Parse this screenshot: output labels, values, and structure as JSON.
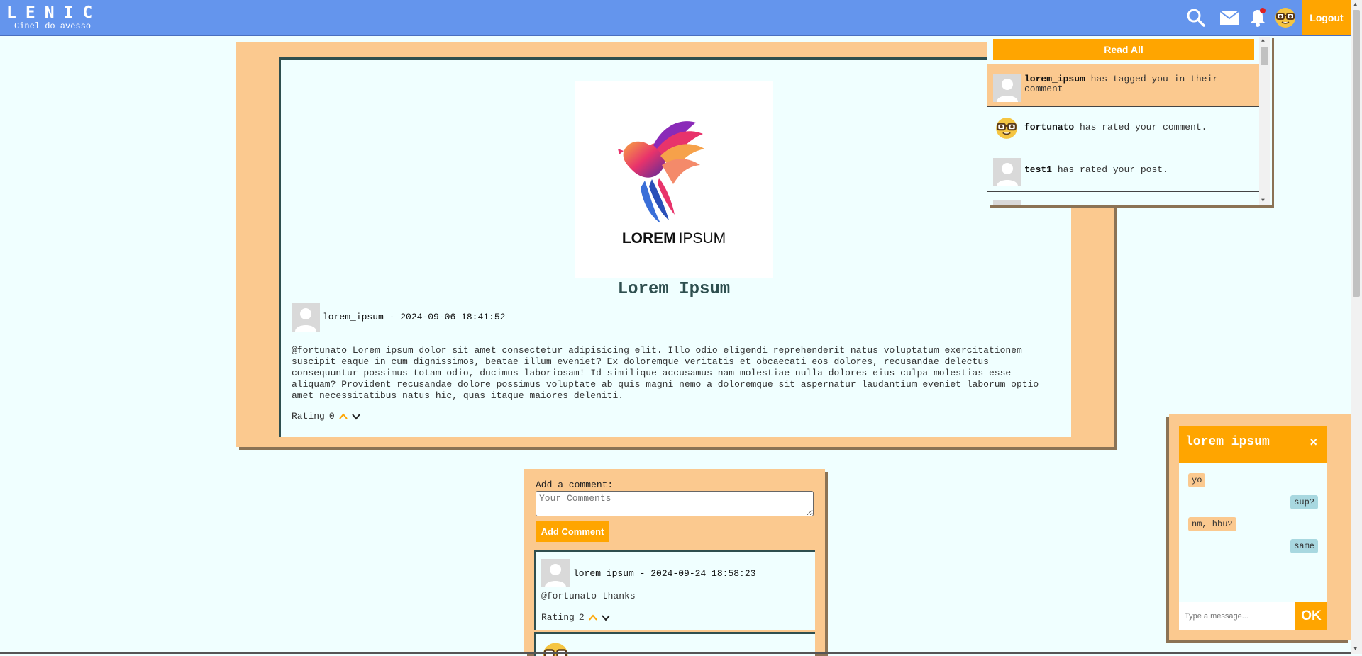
{
  "header": {
    "logo_title": "LENIC",
    "logo_subtitle": "Cinel do avesso",
    "logout_label": "Logout",
    "icons": [
      "search-icon",
      "mail-icon",
      "bell-icon",
      "profile-avatar"
    ]
  },
  "notifications": {
    "read_all_label": "Read All",
    "items": [
      {
        "user": "lorem_ipsum",
        "text": "has tagged you in their comment",
        "unread": true,
        "avatar": "default"
      },
      {
        "user": "fortunato",
        "text": "has rated your comment.",
        "unread": false,
        "avatar": "nerd-emoji"
      },
      {
        "user": "test1",
        "text": "has rated your post.",
        "unread": false,
        "avatar": "default"
      }
    ]
  },
  "post": {
    "image_text_1": "LOREM",
    "image_text_2": "IPSUM",
    "title": "Lorem Ipsum",
    "author": "lorem_ipsum",
    "date": "2024-09-06 18:41:52",
    "meta_separator": " - ",
    "body": "@fortunato Lorem ipsum dolor sit amet consectetur adipisicing elit. Illo odio eligendi reprehenderit natus voluptatum exercitationem suscipit eaque in cum dignissimos, beatae illum eveniet? Ex doloremque veritatis et obcaecati eos dolores, recusandae delectus consequuntur possimus totam odio, ducimus laboriosam! Id similique accusamus nam molestiae nulla dolores eius culpa molestias esse aliquam? Provident recusandae dolore possimus voluptate ab quis magni nemo a doloremque sit aspernatur laudantium eveniet laborum optio amet necessitatibus natus hic, quas itaque maiores deleniti.",
    "rating_label": "Rating",
    "rating_value": "0"
  },
  "comments": {
    "add_label": "Add a comment:",
    "placeholder": "Your Comments",
    "add_button": "Add Comment",
    "items": [
      {
        "author": "lorem_ipsum",
        "date": "2024-09-24 18:58:23",
        "text": "@fortunato thanks",
        "rating_label": "Rating",
        "rating_value": "2"
      }
    ]
  },
  "chat": {
    "title": "lorem_ipsum",
    "close": "×",
    "messages": [
      {
        "text": "yo",
        "dir": "in"
      },
      {
        "text": "sup?",
        "dir": "out"
      },
      {
        "text": "nm, hbu?",
        "dir": "in"
      },
      {
        "text": "same",
        "dir": "out"
      }
    ],
    "input_placeholder": "Type a message...",
    "send_label": "OK"
  },
  "colors": {
    "topbar": "#6495ed",
    "accent": "#ffa500",
    "card": "#fbc98f",
    "background": "#f0ffff"
  }
}
